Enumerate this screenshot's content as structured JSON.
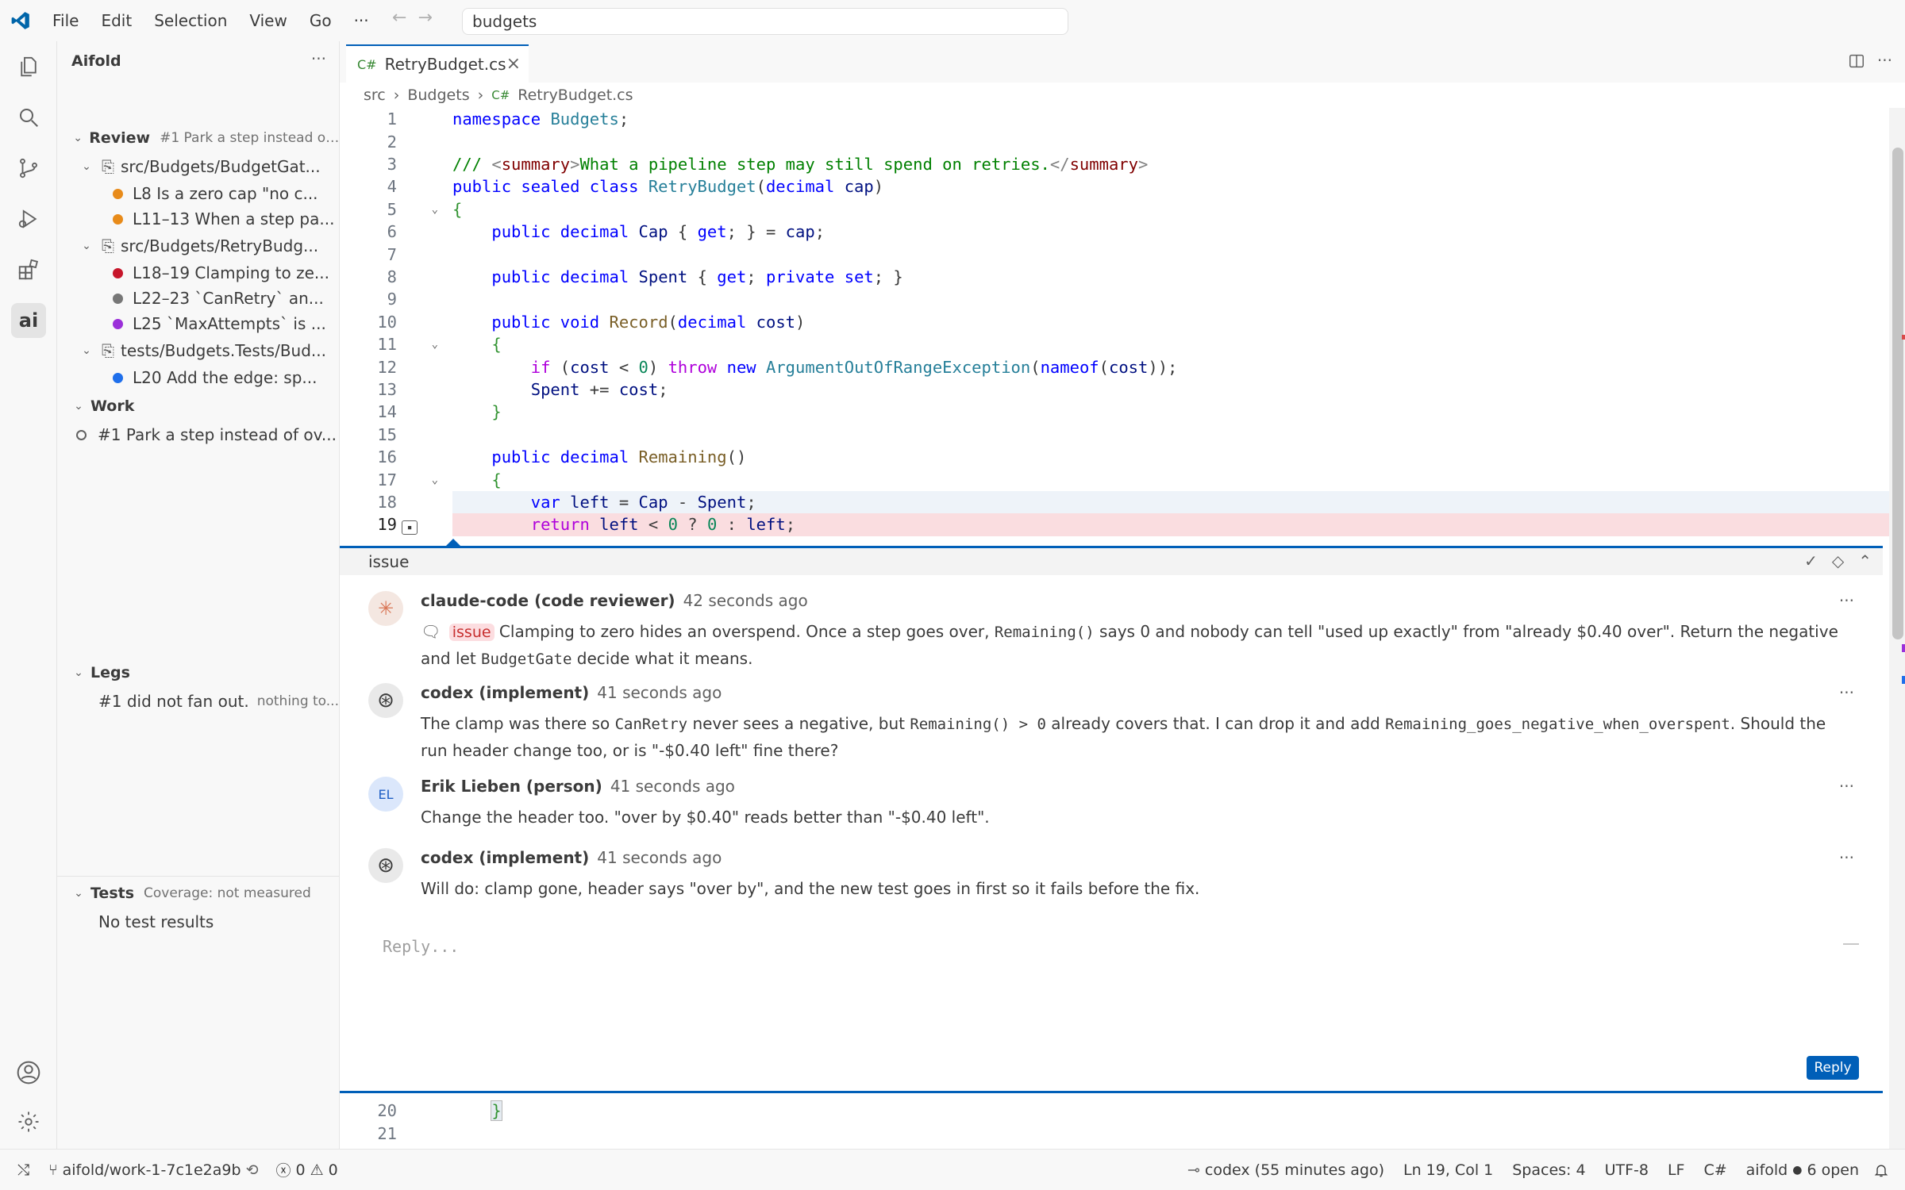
{
  "menu": [
    "File",
    "Edit",
    "Selection",
    "View",
    "Go"
  ],
  "search": {
    "value": "budgets"
  },
  "sidebar": {
    "title": "Aifold",
    "review": {
      "label": "Review",
      "subtitle": "#1 Park a step instead of o...",
      "files": [
        {
          "path": "src/Budgets/BudgetGat...",
          "items": [
            {
              "color": "#e88b1a",
              "text": "L8  Is a zero cap \"no c..."
            },
            {
              "color": "#e88b1a",
              "text": "L11–13  When a step pa..."
            }
          ]
        },
        {
          "path": "src/Budgets/RetryBudg...",
          "items": [
            {
              "color": "#c7162b",
              "text": "L18–19  Clamping to ze..."
            },
            {
              "color": "#777777",
              "text": "L22–23  `CanRetry` an..."
            },
            {
              "color": "#9b30d9",
              "text": "L25  `MaxAttempts` is ..."
            }
          ]
        },
        {
          "path": "tests/Budgets.Tests/Bud...",
          "items": [
            {
              "color": "#1f6feb",
              "text": "L20  Add the edge: sp..."
            }
          ]
        }
      ]
    },
    "work": {
      "label": "Work",
      "item": "#1 Park a step instead of ov..."
    },
    "legs": {
      "label": "Legs",
      "item": "#1 did not fan out.",
      "note": "nothing to..."
    },
    "tests": {
      "label": "Tests",
      "coverage": "Coverage: not measured",
      "item": "No test results"
    }
  },
  "editor": {
    "tab": "RetryBudget.cs",
    "breadcrumb": [
      "src",
      "Budgets",
      "RetryBudget.cs"
    ],
    "bottom_lines": [
      "20",
      "21"
    ],
    "bottom_code": "}"
  },
  "thread": {
    "label": "issue",
    "comments": [
      {
        "author": "claude-code (code reviewer)",
        "time": "42 seconds ago",
        "avatar": "✳",
        "badge": "issue",
        "parts": [
          "Clamping to zero hides an overspend. Once a step goes over, ",
          "Remaining()",
          " says 0 and nobody can tell \"used up exactly\" from \"already $0.40 over\". Return the negative and let ",
          "BudgetGate",
          " decide what it means."
        ]
      },
      {
        "author": "codex (implement)",
        "time": "41 seconds ago",
        "avatar": "⊛",
        "parts": [
          "The clamp was there so ",
          "CanRetry",
          " never sees a negative, but ",
          "Remaining() > 0",
          " already covers that. I can drop it and add ",
          "Remaining_goes_negative_when_overspent",
          ". Should the run header change too, or is \"-$0.40 left\" fine there?"
        ]
      },
      {
        "author": "Erik Lieben (person)",
        "time": "41 seconds ago",
        "avatar": "EL",
        "text": "Change the header too. \"over by $0.40\" reads better than \"-$0.40 left\"."
      },
      {
        "author": "codex (implement)",
        "time": "41 seconds ago",
        "avatar": "⊛",
        "text": "Will do: clamp gone, header says \"over by\", and the new test goes in first so it fails before the fix."
      }
    ],
    "reply_placeholder": "Reply...",
    "reply_button": "Reply"
  },
  "status": {
    "branch": "aifold/work-1-7c1e2a9b",
    "errors": "0",
    "warnings": "0",
    "agent": "codex (55 minutes ago)",
    "position": "Ln 19, Col 1",
    "spaces": "Spaces: 4",
    "encoding": "UTF-8",
    "eol": "LF",
    "language": "C#",
    "aifold": "aifold",
    "open": "6 open"
  }
}
